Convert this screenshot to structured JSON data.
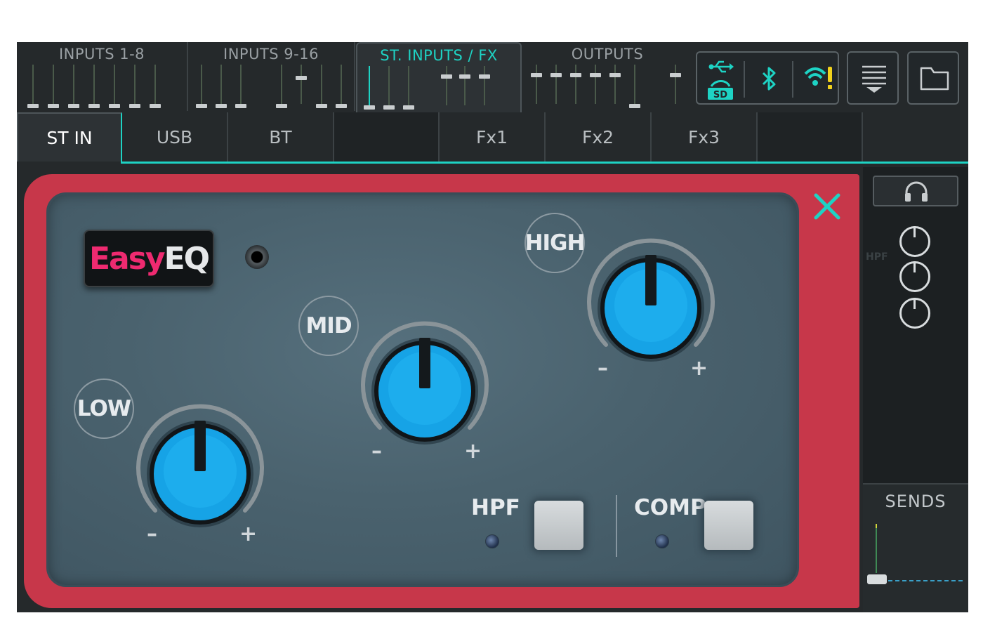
{
  "banks": [
    "INPUTS 1-8",
    "INPUTS 9-16",
    "ST. INPUTS / FX",
    "OUTPUTS"
  ],
  "active_bank": "ST. INPUTS / FX",
  "status_icons": [
    "usb-icon",
    "sd-card-icon",
    "bluetooth-icon",
    "wifi-warning-icon"
  ],
  "toolbar_icons": [
    "menu-icon",
    "folder-icon"
  ],
  "tabs": [
    "ST IN",
    "USB",
    "BT",
    "",
    "Fx1",
    "Fx2",
    "Fx3",
    ""
  ],
  "active_tab": "ST IN",
  "eq": {
    "logo_easy": "Easy",
    "logo_eq": "EQ",
    "low_label": "LOW",
    "mid_label": "MID",
    "high_label": "HIGH",
    "minus": "–",
    "plus": "+",
    "hpf_label": "HPF",
    "comp_label": "COMP"
  },
  "close_icon": "close-icon",
  "right_panel": {
    "headphones_icon": "headphones-icon",
    "hpf_mini": "HPF",
    "sends_label": "SENDS"
  },
  "colors": {
    "accent": "#1ed3c4",
    "frame_red": "#c7374a",
    "knob_blue": "#16a3e6",
    "logo_pink": "#ee2a70"
  }
}
